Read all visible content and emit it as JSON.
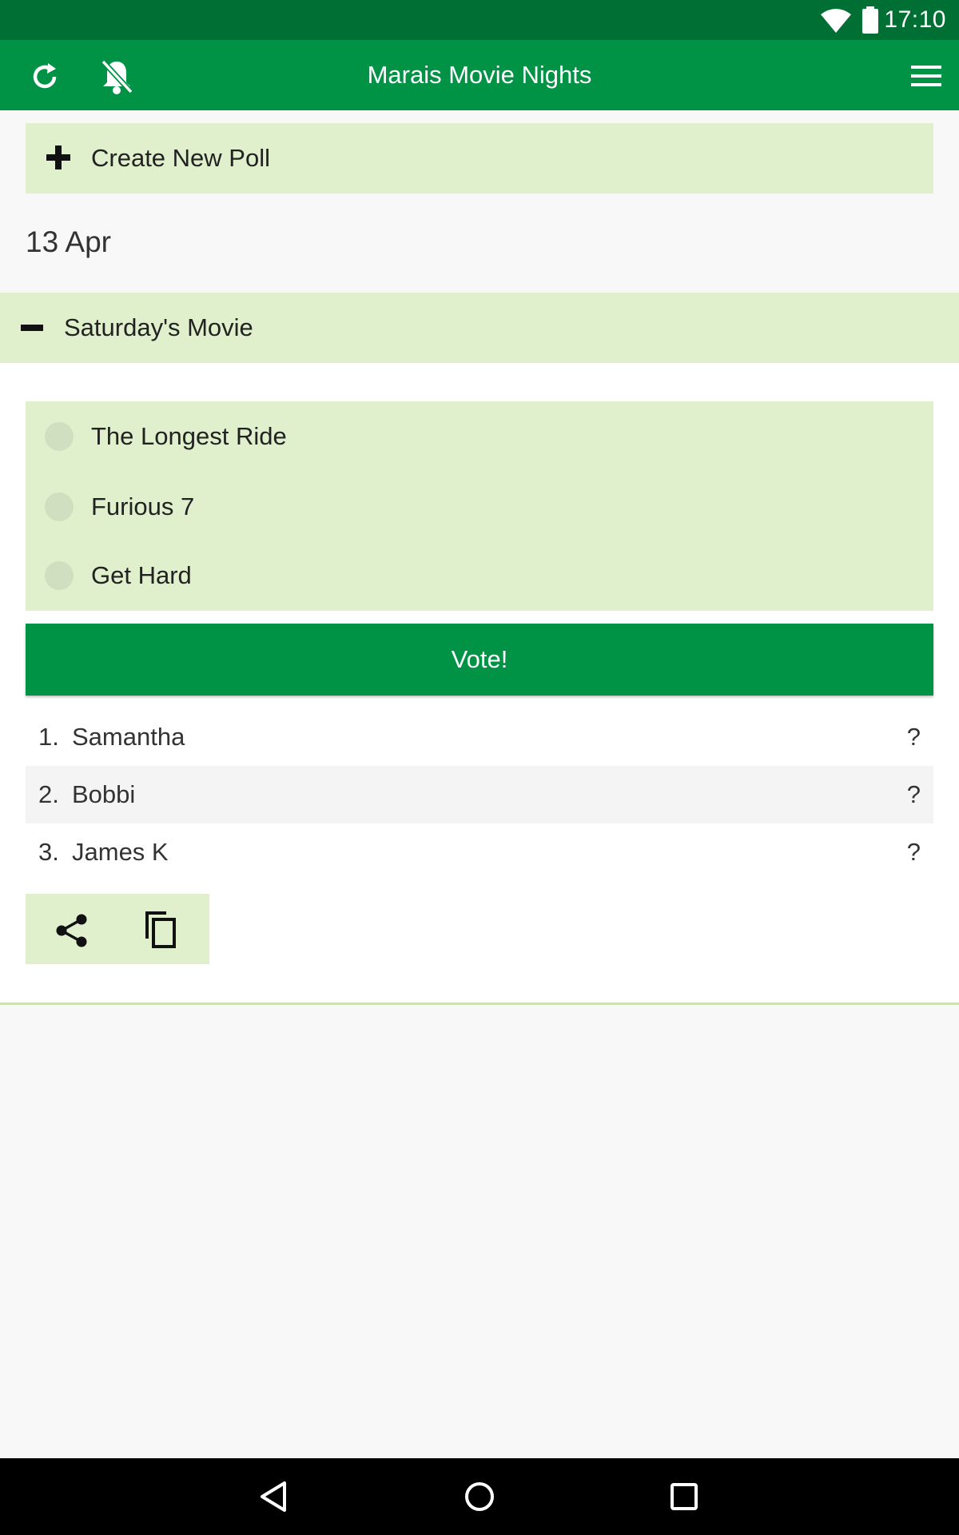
{
  "status_bar": {
    "time": "17:10",
    "icons": [
      "wifi-icon",
      "battery-icon"
    ]
  },
  "app_bar": {
    "title": "Marais Movie Nights",
    "left_icons": [
      "refresh-icon",
      "notifications-off-icon"
    ],
    "right_icon": "menu-icon",
    "color": "#009245"
  },
  "create_poll": {
    "label": "Create New Poll",
    "icon": "plus-icon"
  },
  "date_heading": "13 Apr",
  "poll": {
    "title": "Saturday's Movie",
    "collapse_icon": "minus-icon",
    "options": [
      {
        "label": "The Longest Ride",
        "selected": false
      },
      {
        "label": "Furious 7",
        "selected": false
      },
      {
        "label": "Get Hard",
        "selected": false
      }
    ],
    "vote_label": "Vote!",
    "voters": [
      {
        "num": "1.",
        "name": "Samantha",
        "status": "?"
      },
      {
        "num": "2.",
        "name": "Bobbi",
        "status": "?"
      },
      {
        "num": "3.",
        "name": "James K",
        "status": "?"
      }
    ],
    "actions": [
      "share-icon",
      "copy-icon"
    ]
  },
  "nav_bar": {
    "buttons": [
      "back-icon",
      "home-icon",
      "recents-icon"
    ]
  },
  "colors": {
    "status_bar": "#006f34",
    "primary": "#009245",
    "light_green": "#e1f0cc"
  }
}
